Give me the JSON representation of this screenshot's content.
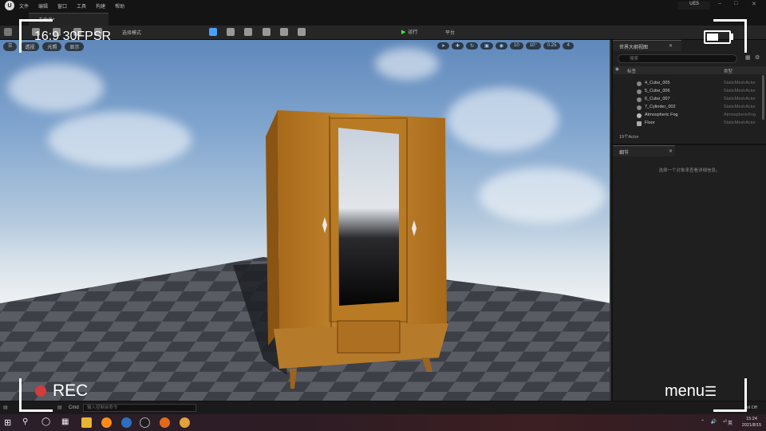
{
  "menubar": {
    "logo": "U",
    "items": [
      "文件",
      "编辑",
      "窗口",
      "工具",
      "构建",
      "帮助"
    ],
    "window_title": "UE5"
  },
  "level_tab": {
    "label": "未命名*"
  },
  "toolbar": {
    "mode_label": "选择模式",
    "play_label": "运行",
    "platforms_label": "平台"
  },
  "viewport": {
    "perspective_label": "透视",
    "lit_label": "光照",
    "show_label": "显示",
    "grid_snap": "10",
    "rotation_snap": "10°",
    "scale_snap": "0.25",
    "camera_speed": "4"
  },
  "outliner": {
    "tab_label": "世界大纲视图",
    "search_placeholder": "搜索",
    "col_label": "标签",
    "col_type": "类型",
    "rows": [
      {
        "label": "4_Cube_005",
        "type": "StaticMeshActor"
      },
      {
        "label": "5_Cube_006",
        "type": "StaticMeshActor"
      },
      {
        "label": "6_Cube_007",
        "type": "StaticMeshActor"
      },
      {
        "label": "7_Cylinder_002",
        "type": "StaticMeshActor"
      },
      {
        "label": "Atmospheric Fog",
        "type": "AtmosphericFog"
      },
      {
        "label": "Floor",
        "type": "StaticMeshActor"
      }
    ],
    "actor_count": "19个Actor"
  },
  "details": {
    "tab_label": "细节",
    "empty_message": "选择一个对象来查看详细信息。"
  },
  "bottombar": {
    "cmd_label": "Cmd",
    "cmd_placeholder": "输入控制台命令",
    "ctrl_off": "rol Off"
  },
  "taskbar": {
    "time": "15:24",
    "date": "2021/8/15",
    "lang": "英"
  },
  "overlay": {
    "format": "16:9 30FPSR",
    "rec_label": "REC",
    "menu_label": "menu",
    "battery_level": 0.55
  },
  "colors": {
    "rec_dot": "#d13c3c",
    "play_green": "#33ff33",
    "wood": "#b97a24"
  }
}
